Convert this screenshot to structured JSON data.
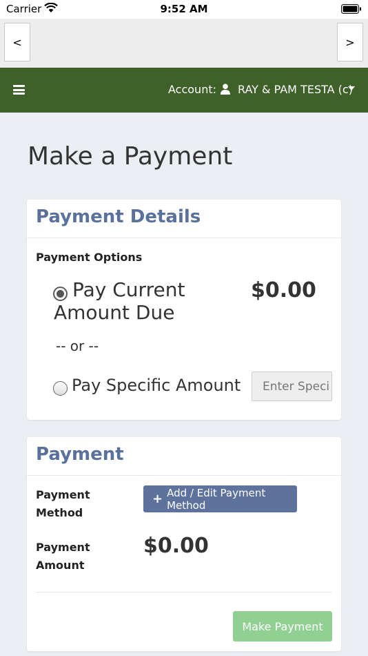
{
  "status_bar": {
    "carrier": "Carrier",
    "time": "9:52 AM"
  },
  "browser_nav": {
    "back_label": "<",
    "forward_label": ">"
  },
  "top_nav": {
    "account_label": "Account:",
    "account_name": "RAY & PAM TESTA (c)"
  },
  "page": {
    "title": "Make a Payment"
  },
  "payment_details": {
    "title": "Payment Details",
    "options_label": "Payment Options",
    "current_option_label": "Pay Current Amount Due",
    "current_amount": "$0.00",
    "or_text": "-- or --",
    "specific_option_label": "Pay Specific Amount",
    "specific_amount_placeholder": "Enter Speci",
    "selected_option": "current"
  },
  "payment": {
    "title": "Payment",
    "method_label": "Payment Method",
    "add_method_button": "Add / Edit Payment Method",
    "amount_label": "Payment Amount",
    "amount_value": "$0.00",
    "submit_button": "Make Payment"
  },
  "colors": {
    "nav_green": "#3d6128",
    "heading_blue": "#5a719b",
    "button_blue": "#5d729c",
    "submit_green_disabled": "#90d092",
    "page_background": "#ebeef3"
  },
  "icons": [
    "wifi-icon",
    "battery-icon",
    "hamburger-icon",
    "user-icon",
    "caret-down-icon",
    "plus-icon"
  ]
}
